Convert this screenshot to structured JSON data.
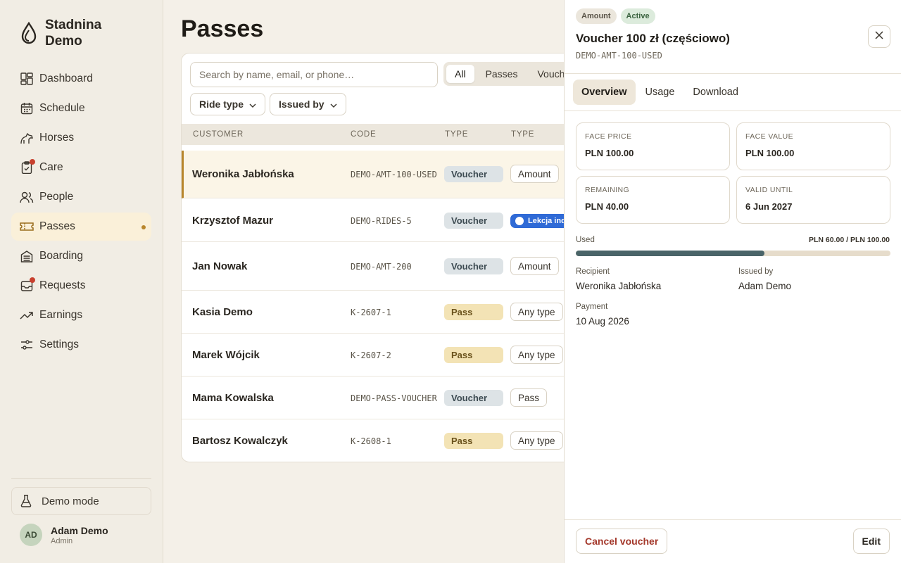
{
  "brand": {
    "name_line1": "Stadnina",
    "name_line2": "Demo"
  },
  "nav": [
    {
      "label": "Dashboard",
      "icon": "dashboard-icon"
    },
    {
      "label": "Schedule",
      "icon": "calendar-icon"
    },
    {
      "label": "Horses",
      "icon": "horse-icon"
    },
    {
      "label": "Care",
      "icon": "clipboard-check-icon",
      "badge": true
    },
    {
      "label": "People",
      "icon": "people-icon"
    },
    {
      "label": "Passes",
      "icon": "ticket-icon",
      "active": true
    },
    {
      "label": "Boarding",
      "icon": "building-icon"
    },
    {
      "label": "Requests",
      "icon": "inbox-icon",
      "badge": true
    },
    {
      "label": "Earnings",
      "icon": "trend-up-icon"
    },
    {
      "label": "Settings",
      "icon": "sliders-icon"
    }
  ],
  "demo_mode": "Demo mode",
  "user": {
    "initials": "AD",
    "name": "Adam Demo",
    "role": "Admin"
  },
  "main": {
    "title": "Passes",
    "search_placeholder": "Search by name, email, or phone…",
    "segments": [
      "All",
      "Passes",
      "Vouchers"
    ],
    "filters": [
      "Ride type",
      "Issued by"
    ],
    "columns": [
      "CUSTOMER",
      "CODE",
      "TYPE",
      "TYPE"
    ],
    "rows": [
      {
        "customer": "Weronika Jabłońska",
        "code": "DEMO-AMT-100-USED",
        "type": "Voucher",
        "kind": "Amount",
        "selected": true
      },
      {
        "customer": "Krzysztof Mazur",
        "code": "DEMO-RIDES-5",
        "type": "Voucher",
        "kind": "Lekcja indywidualna"
      },
      {
        "customer": "Jan Nowak",
        "code": "DEMO-AMT-200",
        "type": "Voucher",
        "kind": "Amount"
      },
      {
        "customer": "Kasia Demo",
        "code": "K-2607-1",
        "type": "Pass",
        "kind": "Any type"
      },
      {
        "customer": "Marek Wójcik",
        "code": "K-2607-2",
        "type": "Pass",
        "kind": "Any type"
      },
      {
        "customer": "Mama Kowalska",
        "code": "DEMO-PASS-VOUCHER",
        "type": "Voucher",
        "kind": "Pass"
      },
      {
        "customer": "Bartosz Kowalczyk",
        "code": "K-2608-1",
        "type": "Pass",
        "kind": "Any type"
      }
    ]
  },
  "panel": {
    "tags": [
      "Amount",
      "Active"
    ],
    "title": "Voucher 100 zł (częściowo)",
    "code": "DEMO-AMT-100-USED",
    "tabs": [
      "Overview",
      "Usage",
      "Download"
    ],
    "stats": [
      {
        "label": "FACE PRICE",
        "value": "PLN 100.00"
      },
      {
        "label": "FACE VALUE",
        "value": "PLN 100.00"
      },
      {
        "label": "REMAINING",
        "value": "PLN 40.00"
      },
      {
        "label": "VALID UNTIL",
        "value": "6 Jun 2027"
      }
    ],
    "used_label": "Used",
    "used_value": "PLN 60.00 / PLN 100.00",
    "used_fraction": 0.6,
    "recipient_label": "Recipient",
    "recipient": "Weronika Jabłońska",
    "issued_by_label": "Issued by",
    "issued_by": "Adam Demo",
    "payment_label": "Payment",
    "payment": "10 Aug 2026",
    "cancel_label": "Cancel voucher",
    "edit_label": "Edit"
  },
  "colors": {
    "accent": "#b8862c",
    "danger": "#a3372a",
    "progress": "#4a6468"
  }
}
